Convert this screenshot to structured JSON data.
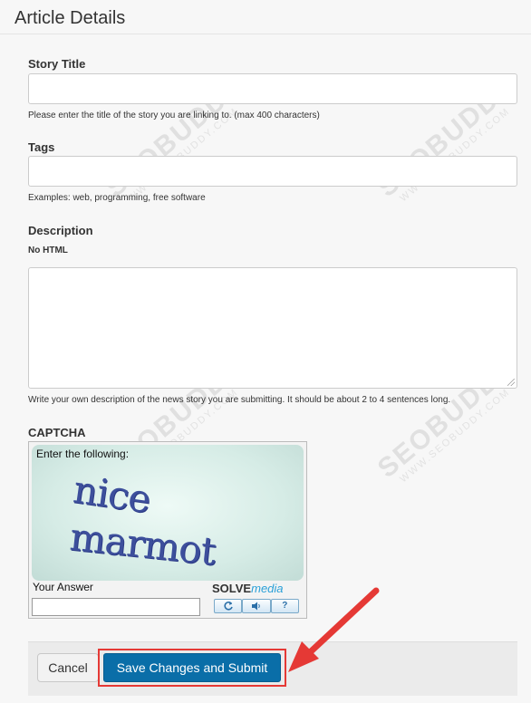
{
  "page": {
    "title": "Article Details"
  },
  "story_title": {
    "label": "Story Title",
    "value": "",
    "help": "Please enter the title of the story you are linking to. (max 400 characters)"
  },
  "tags": {
    "label": "Tags",
    "value": "",
    "help": "Examples: web, programming, free software"
  },
  "description": {
    "label": "Description",
    "sublabel": "No HTML",
    "value": "",
    "help": "Write your own description of the news story you are submitting. It should be about 2 to 4 sentences long."
  },
  "captcha": {
    "label": "CAPTCHA",
    "prompt": "Enter the following:",
    "word1": "nice",
    "word2": "marmot",
    "answer_label": "Your Answer",
    "answer_value": "",
    "brand_solve": "SOLVE",
    "brand_media": "media",
    "buttons": [
      "refresh-icon",
      "audio-icon",
      "help-icon"
    ]
  },
  "actions": {
    "cancel_label": "Cancel",
    "submit_label": "Save Changes and Submit"
  },
  "watermark": {
    "text": "SEOBUDDY",
    "sub": "WWW.SEOBUDDY.COM"
  },
  "colors": {
    "primary": "#0a6ea8",
    "highlight": "#e53935"
  }
}
